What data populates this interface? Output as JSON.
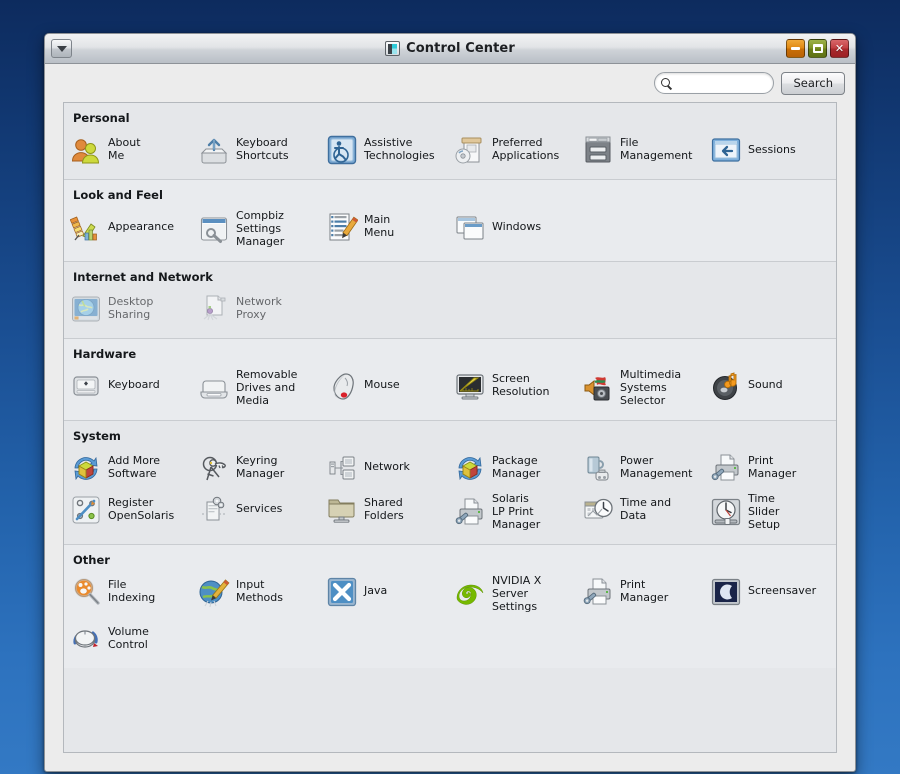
{
  "window": {
    "title": "Control Center",
    "title_icon": "control-center-icon",
    "menu_button_icon": "chevron-down-icon",
    "buttons": [
      {
        "name": "minimize",
        "icon": "minimize-icon"
      },
      {
        "name": "maximize",
        "icon": "maximize-icon"
      },
      {
        "name": "close",
        "icon": "close-icon"
      }
    ]
  },
  "toolbar": {
    "search_icon": "search-icon",
    "search_value": "",
    "search_placeholder": "",
    "search_label": "Search"
  },
  "colors": {
    "desktop_top": "#0d2b5e",
    "desktop_bottom": "#3379c4",
    "window_bg": "#ececec",
    "panel_bg": "#e5e7ea",
    "minimize": "#e08813",
    "maximize": "#7f9426",
    "close": "#c33f42"
  },
  "sections": [
    {
      "title": "Personal",
      "items": [
        {
          "label": "About\nMe",
          "icon": "about-me-icon"
        },
        {
          "label": "Keyboard\nShortcuts",
          "icon": "keyboard-shortcuts-icon"
        },
        {
          "label": "Assistive\nTechnologies",
          "icon": "assistive-technologies-icon"
        },
        {
          "label": "Preferred\nApplications",
          "icon": "preferred-applications-icon"
        },
        {
          "label": "File\nManagement",
          "icon": "file-management-icon"
        },
        {
          "label": "Sessions",
          "icon": "sessions-icon"
        }
      ]
    },
    {
      "title": "Look and Feel",
      "items": [
        {
          "label": "Appearance",
          "icon": "appearance-icon"
        },
        {
          "label": "Compbiz\nSettings\nManager",
          "icon": "compiz-settings-manager-icon"
        },
        {
          "label": "Main\nMenu",
          "icon": "main-menu-icon"
        },
        {
          "label": "Windows",
          "icon": "windows-icon"
        }
      ]
    },
    {
      "title": "Internet and Network",
      "items": [
        {
          "label": "Desktop\nSharing",
          "icon": "desktop-sharing-icon",
          "dim": true
        },
        {
          "label": "Network\nProxy",
          "icon": "network-proxy-icon",
          "dim": true
        }
      ]
    },
    {
      "title": "Hardware",
      "items": [
        {
          "label": "Keyboard",
          "icon": "keyboard-icon"
        },
        {
          "label": "Removable\nDrives and\nMedia",
          "icon": "removable-drives-icon"
        },
        {
          "label": "Mouse",
          "icon": "mouse-icon"
        },
        {
          "label": "Screen\nResolution",
          "icon": "screen-resolution-icon"
        },
        {
          "label": "Multimedia\nSystems\nSelector",
          "icon": "multimedia-systems-selector-icon"
        },
        {
          "label": "Sound",
          "icon": "sound-icon"
        }
      ]
    },
    {
      "title": "System",
      "items": [
        {
          "label": "Add More\nSoftware",
          "icon": "add-more-software-icon"
        },
        {
          "label": "Keyring\nManager",
          "icon": "keyring-manager-icon"
        },
        {
          "label": "Network",
          "icon": "network-icon"
        },
        {
          "label": "Package\nManager",
          "icon": "package-manager-icon"
        },
        {
          "label": "Power\nManagement",
          "icon": "power-management-icon"
        },
        {
          "label": "Print\nManager",
          "icon": "print-manager-icon"
        },
        {
          "label": "Register\nOpenSolaris",
          "icon": "register-opensolaris-icon"
        },
        {
          "label": "Services",
          "icon": "services-icon"
        },
        {
          "label": "Shared\nFolders",
          "icon": "shared-folders-icon"
        },
        {
          "label": "Solaris\nLP Print\nManager",
          "icon": "solaris-lp-print-manager-icon"
        },
        {
          "label": "Time and\nData",
          "icon": "time-and-date-icon"
        },
        {
          "label": "Time\nSlider\nSetup",
          "icon": "time-slider-setup-icon"
        }
      ]
    },
    {
      "title": "Other",
      "items": [
        {
          "label": "File\nIndexing",
          "icon": "file-indexing-icon"
        },
        {
          "label": "Input\nMethods",
          "icon": "input-methods-icon"
        },
        {
          "label": "Java",
          "icon": "java-icon"
        },
        {
          "label": "NVIDIA X\nServer\nSettings",
          "icon": "nvidia-x-server-settings-icon"
        },
        {
          "label": "Print\nManager",
          "icon": "print-manager-icon"
        },
        {
          "label": "Screensaver",
          "icon": "screensaver-icon"
        },
        {
          "label": "Volume\nControl",
          "icon": "volume-control-icon"
        }
      ]
    }
  ]
}
